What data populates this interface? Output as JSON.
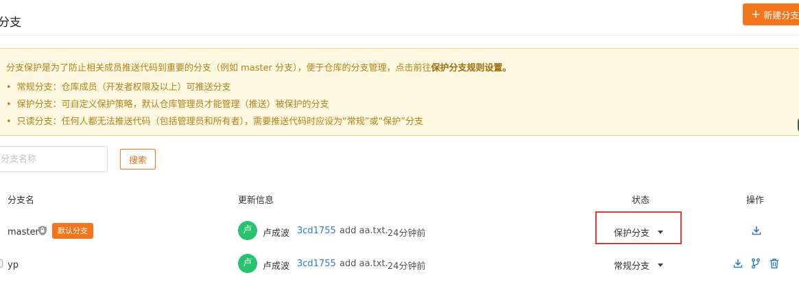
{
  "header": {
    "title": "分支",
    "new_branch_label": "新建分支",
    "new_branch_icon": "plus-icon"
  },
  "notice": {
    "intro": "分支保护是为了防止相关成员推送代码到重要的分支（例如 master 分支），便于仓库的分支管理，点击前往",
    "intro_link": "保护分支规则设置。",
    "items": [
      "常规分支：仓库成员（开发者权限及以上）可推送分支",
      "保护分支：可自定义保护策略，默认仓库管理员才能管理（推送）被保护的分支",
      "只读分支：任何人都无法推送代码（包括管理员和所有者），需要推送代码时应设为“常规”或“保护”分支"
    ]
  },
  "search": {
    "placeholder": "分支名称",
    "value": "",
    "button_label": "搜索"
  },
  "table": {
    "headers": {
      "name": "分支名",
      "update": "更新信息",
      "status": "状态",
      "actions": "操作"
    },
    "rows": [
      {
        "name": "master",
        "badge": "默认分支",
        "avatar": "卢",
        "author": "卢成波",
        "hash": "3cd1755",
        "message": "add aa.txt.",
        "time": "24分钟前",
        "status": "保护分支"
      },
      {
        "name": "yp",
        "avatar": "卢",
        "author": "卢成波",
        "hash": "3cd1755",
        "message": "add aa.txt.",
        "time": "24分钟前",
        "status": "常规分支"
      }
    ]
  },
  "colors": {
    "accent": "#f5751d",
    "notice_bg": "#fcf8e1",
    "notice_text": "#b58114",
    "link": "#2b7bc1",
    "avatar": "#27c26b",
    "highlight": "#e0393a"
  }
}
